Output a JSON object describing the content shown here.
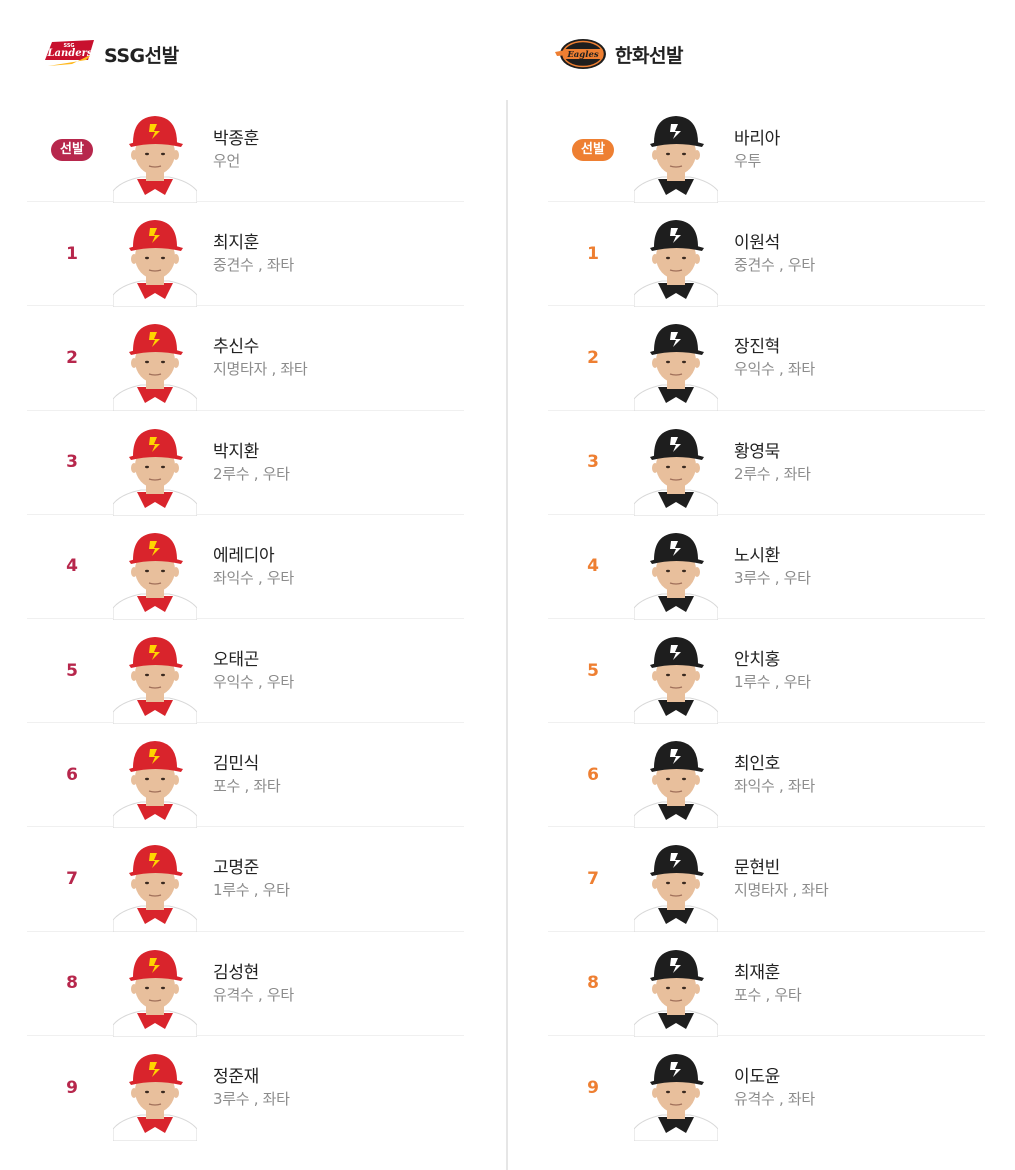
{
  "teams": [
    {
      "side": "left",
      "title": "SSG선발",
      "logo_text": "Landers",
      "logo_sub": "SSG",
      "logo_icon": "ssg-landers-logo",
      "accent": "#b7274c",
      "cap_color": "#d9242c",
      "cap_logo_color": "#ffd400",
      "jersey_color": "#ffffff",
      "neck_color": "#d9242c",
      "players": [
        {
          "order": "선발",
          "name": "박종훈",
          "detail": "우언"
        },
        {
          "order": "1",
          "name": "최지훈",
          "detail": "중견수 , 좌타"
        },
        {
          "order": "2",
          "name": "추신수",
          "detail": "지명타자 , 좌타"
        },
        {
          "order": "3",
          "name": "박지환",
          "detail": "2루수 , 우타"
        },
        {
          "order": "4",
          "name": "에레디아",
          "detail": "좌익수 , 우타"
        },
        {
          "order": "5",
          "name": "오태곤",
          "detail": "우익수 , 우타"
        },
        {
          "order": "6",
          "name": "김민식",
          "detail": "포수 , 좌타"
        },
        {
          "order": "7",
          "name": "고명준",
          "detail": "1루수 , 우타"
        },
        {
          "order": "8",
          "name": "김성현",
          "detail": "유격수 , 우타"
        },
        {
          "order": "9",
          "name": "정준재",
          "detail": "3루수 , 좌타"
        }
      ]
    },
    {
      "side": "right",
      "title": "한화선발",
      "logo_text": "Eagles",
      "logo_sub": "",
      "logo_icon": "hanwha-eagles-logo",
      "accent": "#ee7f32",
      "cap_color": "#1e1e1e",
      "cap_logo_color": "#ffffff",
      "jersey_color": "#ffffff",
      "neck_color": "#1e1e1e",
      "players": [
        {
          "order": "선발",
          "name": "바리아",
          "detail": "우투"
        },
        {
          "order": "1",
          "name": "이원석",
          "detail": "중견수 , 우타"
        },
        {
          "order": "2",
          "name": "장진혁",
          "detail": "우익수 , 좌타"
        },
        {
          "order": "3",
          "name": "황영묵",
          "detail": "2루수 , 좌타"
        },
        {
          "order": "4",
          "name": "노시환",
          "detail": "3루수 , 우타"
        },
        {
          "order": "5",
          "name": "안치홍",
          "detail": "1루수 , 우타"
        },
        {
          "order": "6",
          "name": "최인호",
          "detail": "좌익수 , 좌타"
        },
        {
          "order": "7",
          "name": "문현빈",
          "detail": "지명타자 , 좌타"
        },
        {
          "order": "8",
          "name": "최재훈",
          "detail": "포수 , 우타"
        },
        {
          "order": "9",
          "name": "이도윤",
          "detail": "유격수 , 좌타"
        }
      ]
    }
  ]
}
